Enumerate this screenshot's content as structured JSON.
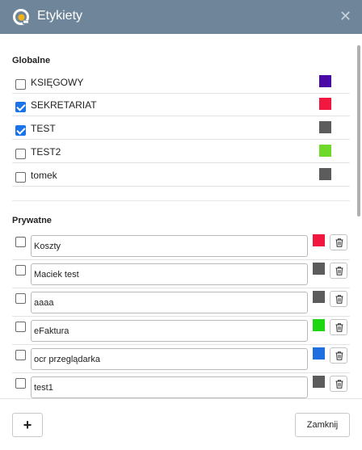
{
  "window": {
    "title": "Etykiety",
    "close_symbol": "✕"
  },
  "global": {
    "heading": "Globalne",
    "labels": [
      {
        "name": "KSIĘGOWY",
        "checked": false,
        "color": "#4b0aa6"
      },
      {
        "name": "SEKRETARIAT",
        "checked": true,
        "color": "#f2173f"
      },
      {
        "name": "TEST",
        "checked": true,
        "color": "#5c5c5c"
      },
      {
        "name": "TEST2",
        "checked": false,
        "color": "#6fd92a"
      },
      {
        "name": "tomek",
        "checked": false,
        "color": "#5c5c5c"
      }
    ]
  },
  "private": {
    "heading": "Prywatne",
    "labels": [
      {
        "name": "Koszty",
        "checked": false,
        "color": "#f2173f"
      },
      {
        "name": "Maciek test",
        "checked": false,
        "color": "#5c5c5c"
      },
      {
        "name": "aaaa",
        "checked": false,
        "color": "#5c5c5c"
      },
      {
        "name": "eFaktura",
        "checked": false,
        "color": "#1fd612"
      },
      {
        "name": "ocr przeglądarka",
        "checked": false,
        "color": "#1f6fe0"
      },
      {
        "name": "test1",
        "checked": false,
        "color": "#5c5c5c"
      }
    ]
  },
  "footer": {
    "add_label": "+",
    "close_label": "Zamknij"
  }
}
